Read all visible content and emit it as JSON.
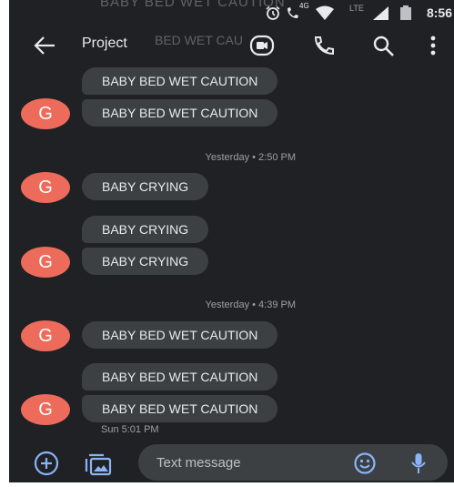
{
  "status_bar": {
    "time": "8:56",
    "network": "LTE",
    "net_small": "4G",
    "icons": [
      "alarm-icon",
      "phone-hd-icon",
      "wifi-icon",
      "signal-icon",
      "battery-icon"
    ]
  },
  "app_bar": {
    "title": "Project",
    "ghost_text_top": "BABY BED WET CAUTION",
    "ghost_text_behind": "BED WET CAU",
    "actions": [
      "video-call-icon",
      "phone-call-icon",
      "search-icon",
      "overflow-menu-icon"
    ]
  },
  "messages": [
    {
      "text": "BABY BED WET CAUTION"
    },
    {
      "text": "BABY BED WET CAUTION",
      "avatar": "G"
    },
    {
      "timestamp": "Yesterday • 2:50 PM"
    },
    {
      "text": "BABY CRYING",
      "avatar": "G"
    },
    {
      "text": "BABY CRYING"
    },
    {
      "text": "BABY CRYING",
      "avatar": "G"
    },
    {
      "timestamp": "Yesterday • 4:39 PM"
    },
    {
      "text": "BABY BED WET CAUTION",
      "avatar": "G"
    },
    {
      "text": "BABY BED WET CAUTION"
    },
    {
      "text": "BABY BED WET CAUTION",
      "avatar": "G"
    }
  ],
  "sent_time": "Sun 5:01 PM",
  "compose": {
    "placeholder": "Text message",
    "value": ""
  },
  "colors": {
    "background": "#202124",
    "bubble": "#3c4043",
    "avatar": "#ed6b5b",
    "text": "#e8eaed",
    "accent": "#8ab4f8"
  }
}
